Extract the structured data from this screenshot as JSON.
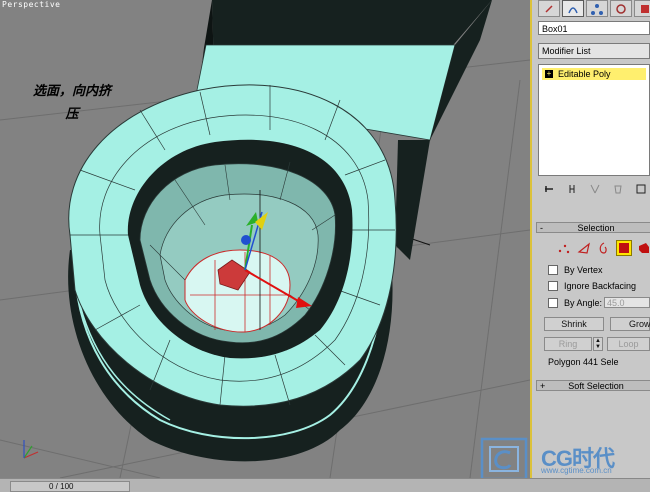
{
  "viewport": {
    "label": "Perspective",
    "annotation_line1": "选面，向内挤",
    "annotation_line2": "压",
    "mesh_color": "#a5f0e4",
    "mesh_dark": "#16211f"
  },
  "timeline": {
    "frame": "0 / 100"
  },
  "command_panel": {
    "tabs": [
      "create-icon",
      "modify-icon",
      "hierarchy-icon",
      "motion-icon",
      "display-icon"
    ],
    "object_name": "Box01",
    "modifier_list_label": "Modifier List",
    "stack_item": "Editable Poly",
    "stack_tools": [
      "pin-stack-icon",
      "show-end-result-icon",
      "make-unique-icon",
      "remove-modifier-icon",
      "configure-modifier-icon"
    ]
  },
  "selection_rollout": {
    "title": "Selection",
    "toggle": "-",
    "levels": [
      "vertex-icon",
      "edge-icon",
      "border-icon",
      "polygon-icon",
      "element-icon"
    ],
    "active_level": "polygon-icon",
    "by_vertex": "By Vertex",
    "ignore_backfacing": "Ignore Backfacing",
    "by_angle": "By Angle:",
    "angle_value": "45.0",
    "shrink": "Shrink",
    "grow": "Grow",
    "ring": "Ring",
    "loop": "Loop",
    "status": "Polygon 441 Sele"
  },
  "soft_selection_rollout": {
    "title": "Soft Selection",
    "toggle": "+"
  },
  "watermark": {
    "brand": "CG时代",
    "url": "www.cgtime.com.cn"
  }
}
